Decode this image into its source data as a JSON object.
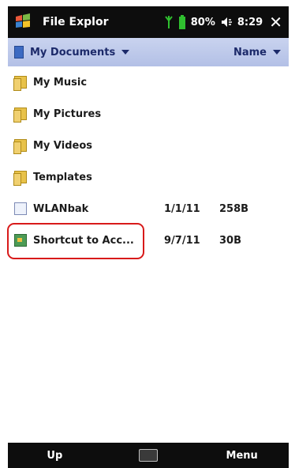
{
  "titlebar": {
    "start_icon": "windows-flag-icon",
    "title": "File Explor",
    "battery": "80%",
    "time": "8:29",
    "close": "✕",
    "icons": [
      "signal-icon",
      "battery-icon",
      "speaker-icon"
    ]
  },
  "pathbar": {
    "folder": "My Documents",
    "sort": "Name"
  },
  "files": [
    {
      "name": "My Music",
      "icon": "folder-icon",
      "date": "",
      "size": ""
    },
    {
      "name": "My Pictures",
      "icon": "folder-icon",
      "date": "",
      "size": ""
    },
    {
      "name": "My Videos",
      "icon": "folder-icon",
      "date": "",
      "size": ""
    },
    {
      "name": "Templates",
      "icon": "folder-icon",
      "date": "",
      "size": ""
    },
    {
      "name": "WLANbak",
      "icon": "file-icon",
      "date": "1/1/11",
      "size": "258B"
    },
    {
      "name": "Shortcut to Acc...",
      "icon": "shortcut-icon",
      "date": "9/7/11",
      "size": "30B"
    }
  ],
  "softkeys": {
    "left": "Up",
    "right": "Menu",
    "center_icon": "keyboard-icon"
  },
  "colors": {
    "titlebar_bg": "#0d0d0d",
    "pathbar_bg": "#b9c5e8",
    "highlight": "#d81a1a"
  }
}
